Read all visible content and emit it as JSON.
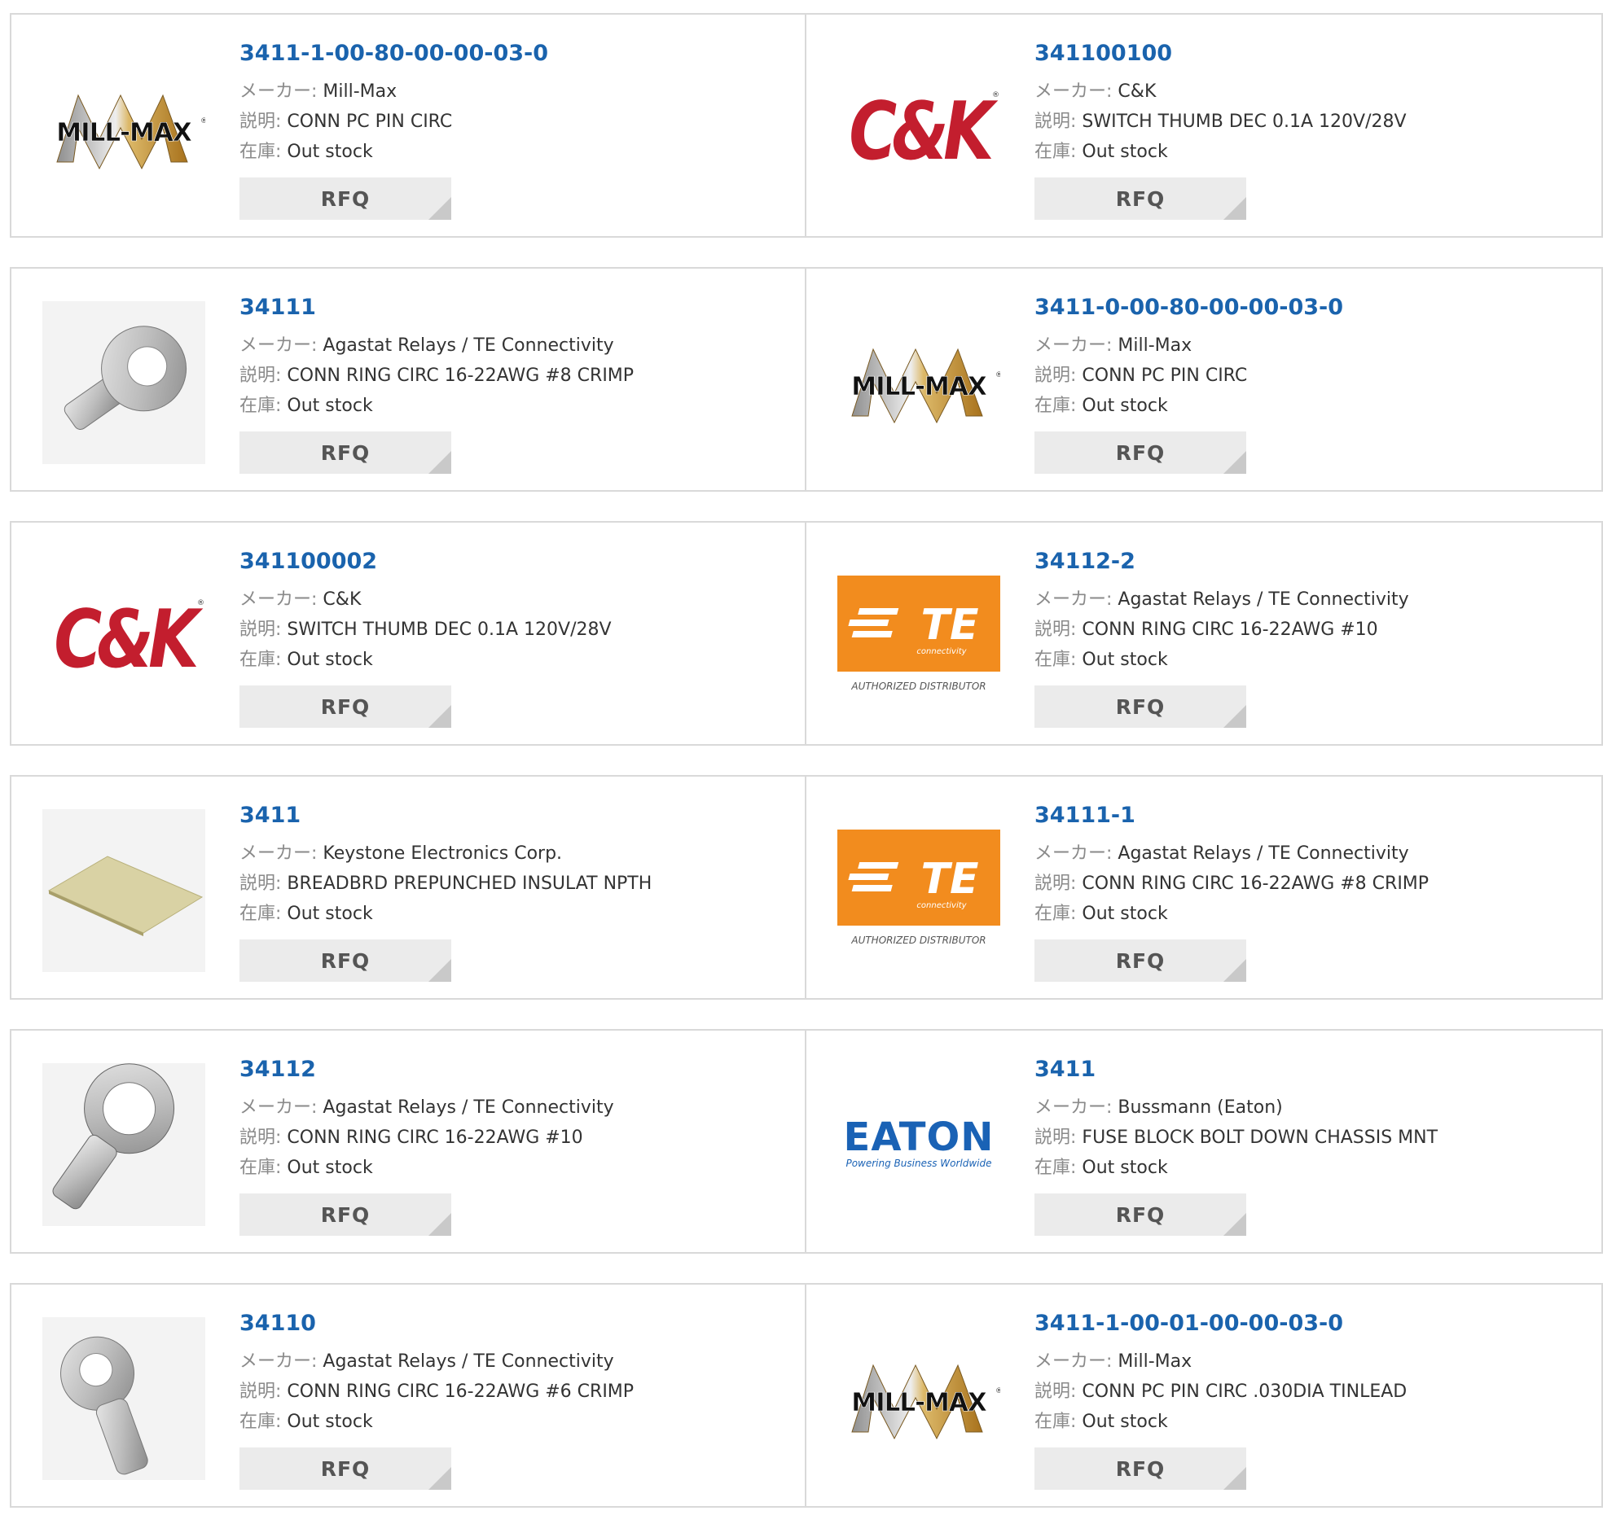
{
  "labels": {
    "maker": "メーカー:",
    "description": "説明:",
    "stock": "在庫:",
    "rfq": "RFQ"
  },
  "colors": {
    "part_number": "#1a63ad",
    "label": "#8a8a8a",
    "border": "#d9d9d9",
    "rfq_bg": "#ebebeb",
    "te_orange": "#f28c1e",
    "ck_red": "#c31e2e",
    "eaton_blue": "#1a62b5"
  },
  "products": [
    {
      "part": "3411-1-00-80-00-00-03-0",
      "maker": "Mill-Max",
      "desc": "CONN PC PIN CIRC",
      "stock": "Out stock",
      "image": "mill-max-logo"
    },
    {
      "part": "341100100",
      "maker": "C&K",
      "desc": "SWITCH THUMB DEC 0.1A 120V/28V",
      "stock": "Out stock",
      "image": "ck-logo"
    },
    {
      "part": "34111",
      "maker": "Agastat Relays / TE Connectivity",
      "desc": "CONN RING CIRC 16-22AWG #8 CRIMP",
      "stock": "Out stock",
      "image": "ring-terminal-photo"
    },
    {
      "part": "3411-0-00-80-00-00-03-0",
      "maker": "Mill-Max",
      "desc": "CONN PC PIN CIRC",
      "stock": "Out stock",
      "image": "mill-max-logo"
    },
    {
      "part": "341100002",
      "maker": "C&K",
      "desc": "SWITCH THUMB DEC 0.1A 120V/28V",
      "stock": "Out stock",
      "image": "ck-logo"
    },
    {
      "part": "34112-2",
      "maker": "Agastat Relays / TE Connectivity",
      "desc": "CONN RING CIRC 16-22AWG #10",
      "stock": "Out stock",
      "image": "te-logo"
    },
    {
      "part": "3411",
      "maker": "Keystone Electronics Corp.",
      "desc": "BREADBRD PREPUNCHED INSULAT NPTH",
      "stock": "Out stock",
      "image": "breadboard-photo"
    },
    {
      "part": "34111-1",
      "maker": "Agastat Relays / TE Connectivity",
      "desc": "CONN RING CIRC 16-22AWG #8 CRIMP",
      "stock": "Out stock",
      "image": "te-logo"
    },
    {
      "part": "34112",
      "maker": "Agastat Relays / TE Connectivity",
      "desc": "CONN RING CIRC 16-22AWG #10",
      "stock": "Out stock",
      "image": "ring-terminal-photo-large"
    },
    {
      "part": "3411",
      "maker": "Bussmann (Eaton)",
      "desc": "FUSE BLOCK BOLT DOWN CHASSIS MNT",
      "stock": "Out stock",
      "image": "eaton-logo"
    },
    {
      "part": "34110",
      "maker": "Agastat Relays / TE Connectivity",
      "desc": "CONN RING CIRC 16-22AWG #6 CRIMP",
      "stock": "Out stock",
      "image": "ring-terminal-photo-upright"
    },
    {
      "part": "3411-1-00-01-00-00-03-0",
      "maker": "Mill-Max",
      "desc": "CONN PC PIN CIRC .030DIA TINLEAD",
      "stock": "Out stock",
      "image": "mill-max-logo"
    }
  ],
  "logos": {
    "mill_max": "MILL-MAX",
    "ck": "C&K",
    "te": "TE",
    "te_sub": "connectivity",
    "te_authorized": "AUTHORIZED DISTRIBUTOR",
    "eaton": "EATON",
    "eaton_tagline": "Powering Business Worldwide"
  }
}
